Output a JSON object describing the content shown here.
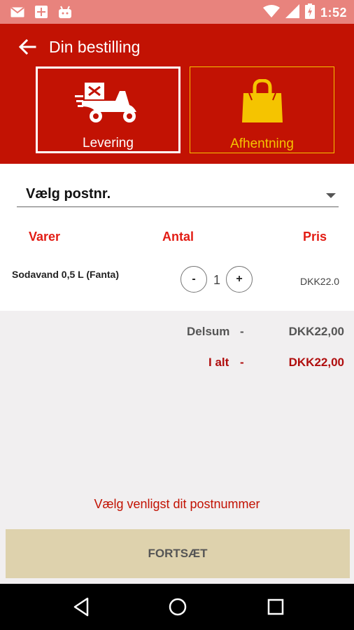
{
  "status_bar": {
    "time": "1:52",
    "icons": [
      "gmail-icon",
      "calendar-plus-icon",
      "android-icon",
      "wifi-icon",
      "signal-icon",
      "battery-icon"
    ]
  },
  "header": {
    "title": "Din bestilling",
    "back_icon": "arrow-left-icon"
  },
  "delivery_modes": [
    {
      "label": "Levering",
      "icon": "scooter-delivery-icon",
      "selected": true
    },
    {
      "label": "Afhentning",
      "icon": "shopping-bag-icon",
      "selected": false
    }
  ],
  "postnr": {
    "label": "Vælg postnr.",
    "icon": "dropdown-caret-icon"
  },
  "table": {
    "columns": [
      "Varer",
      "Antal",
      "Pris"
    ],
    "items": [
      {
        "name": "Sodavand 0,5 L (Fanta)",
        "quantity": "1",
        "price": "DKK22.0",
        "minus": "-",
        "plus": "+"
      }
    ]
  },
  "summary": {
    "subtotal_label": "Delsum",
    "subtotal_dash": "-",
    "subtotal_value": "DKK22,00",
    "total_label": "I alt",
    "total_dash": "-",
    "total_value": "DKK22,00"
  },
  "hint": "Vælg venligst dit postnummer",
  "continue_button": "FORTSÆT",
  "colors": {
    "primary": "#c21203",
    "accent": "#f5c400",
    "status_bar": "#e8837d",
    "button": "#ded2ad"
  },
  "nav_bar": {
    "icons": [
      "nav-back-icon",
      "nav-home-icon",
      "nav-recents-icon"
    ]
  }
}
